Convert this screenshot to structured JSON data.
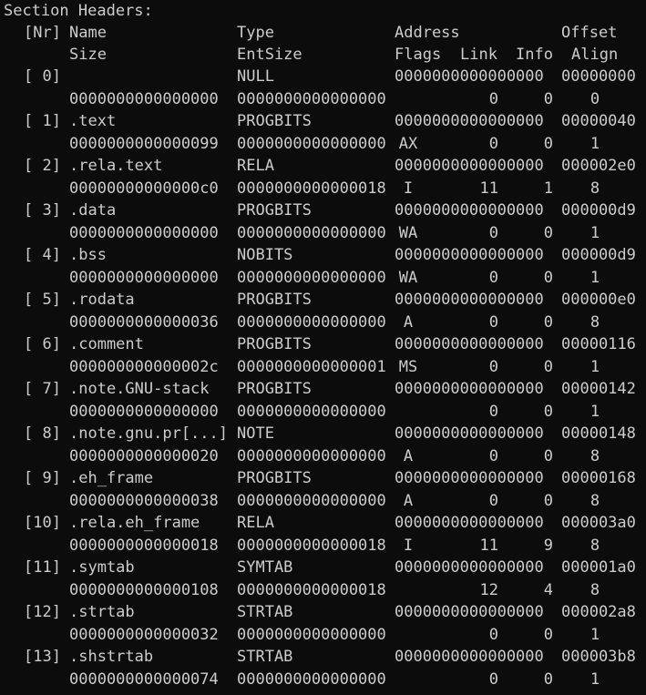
{
  "title": "Section Headers:",
  "header1": {
    "nr": "[Nr]",
    "name": "Name",
    "type": "Type",
    "address": "Address",
    "offset": "Offset"
  },
  "header2": {
    "size": "Size",
    "entsize": "EntSize",
    "flags": "Flags",
    "link": "Link",
    "info": "Info",
    "align": "Align"
  },
  "sections": [
    {
      "nr": "[ 0]",
      "name": "",
      "type": "NULL",
      "address": "0000000000000000",
      "offset": "00000000",
      "size": "0000000000000000",
      "entsize": "0000000000000000",
      "flags": "",
      "link": "0",
      "info": "0",
      "align": "0"
    },
    {
      "nr": "[ 1]",
      "name": ".text",
      "type": "PROGBITS",
      "address": "0000000000000000",
      "offset": "00000040",
      "size": "0000000000000099",
      "entsize": "0000000000000000",
      "flags": "AX",
      "link": "0",
      "info": "0",
      "align": "1"
    },
    {
      "nr": "[ 2]",
      "name": ".rela.text",
      "type": "RELA",
      "address": "0000000000000000",
      "offset": "000002e0",
      "size": "00000000000000c0",
      "entsize": "0000000000000018",
      "flags": "I",
      "link": "11",
      "info": "1",
      "align": "8"
    },
    {
      "nr": "[ 3]",
      "name": ".data",
      "type": "PROGBITS",
      "address": "0000000000000000",
      "offset": "000000d9",
      "size": "0000000000000000",
      "entsize": "0000000000000000",
      "flags": "WA",
      "link": "0",
      "info": "0",
      "align": "1"
    },
    {
      "nr": "[ 4]",
      "name": ".bss",
      "type": "NOBITS",
      "address": "0000000000000000",
      "offset": "000000d9",
      "size": "0000000000000000",
      "entsize": "0000000000000000",
      "flags": "WA",
      "link": "0",
      "info": "0",
      "align": "1"
    },
    {
      "nr": "[ 5]",
      "name": ".rodata",
      "type": "PROGBITS",
      "address": "0000000000000000",
      "offset": "000000e0",
      "size": "0000000000000036",
      "entsize": "0000000000000000",
      "flags": "A",
      "link": "0",
      "info": "0",
      "align": "8"
    },
    {
      "nr": "[ 6]",
      "name": ".comment",
      "type": "PROGBITS",
      "address": "0000000000000000",
      "offset": "00000116",
      "size": "000000000000002c",
      "entsize": "0000000000000001",
      "flags": "MS",
      "link": "0",
      "info": "0",
      "align": "1"
    },
    {
      "nr": "[ 7]",
      "name": ".note.GNU-stack",
      "type": "PROGBITS",
      "address": "0000000000000000",
      "offset": "00000142",
      "size": "0000000000000000",
      "entsize": "0000000000000000",
      "flags": "",
      "link": "0",
      "info": "0",
      "align": "1"
    },
    {
      "nr": "[ 8]",
      "name": ".note.gnu.pr[...]",
      "type": "NOTE",
      "address": "0000000000000000",
      "offset": "00000148",
      "size": "0000000000000020",
      "entsize": "0000000000000000",
      "flags": "A",
      "link": "0",
      "info": "0",
      "align": "8"
    },
    {
      "nr": "[ 9]",
      "name": ".eh_frame",
      "type": "PROGBITS",
      "address": "0000000000000000",
      "offset": "00000168",
      "size": "0000000000000038",
      "entsize": "0000000000000000",
      "flags": "A",
      "link": "0",
      "info": "0",
      "align": "8"
    },
    {
      "nr": "[10]",
      "name": ".rela.eh_frame",
      "type": "RELA",
      "address": "0000000000000000",
      "offset": "000003a0",
      "size": "0000000000000018",
      "entsize": "0000000000000018",
      "flags": "I",
      "link": "11",
      "info": "9",
      "align": "8"
    },
    {
      "nr": "[11]",
      "name": ".symtab",
      "type": "SYMTAB",
      "address": "0000000000000000",
      "offset": "000001a0",
      "size": "0000000000000108",
      "entsize": "0000000000000018",
      "flags": "",
      "link": "12",
      "info": "4",
      "align": "8"
    },
    {
      "nr": "[12]",
      "name": ".strtab",
      "type": "STRTAB",
      "address": "0000000000000000",
      "offset": "000002a8",
      "size": "0000000000000032",
      "entsize": "0000000000000000",
      "flags": "",
      "link": "0",
      "info": "0",
      "align": "1"
    },
    {
      "nr": "[13]",
      "name": ".shstrtab",
      "type": "STRTAB",
      "address": "0000000000000000",
      "offset": "000003b8",
      "size": "0000000000000074",
      "entsize": "0000000000000000",
      "flags": "",
      "link": "0",
      "info": "0",
      "align": "1"
    }
  ],
  "colors": {
    "background": "#0c0c0c",
    "text": "#cccccc"
  }
}
